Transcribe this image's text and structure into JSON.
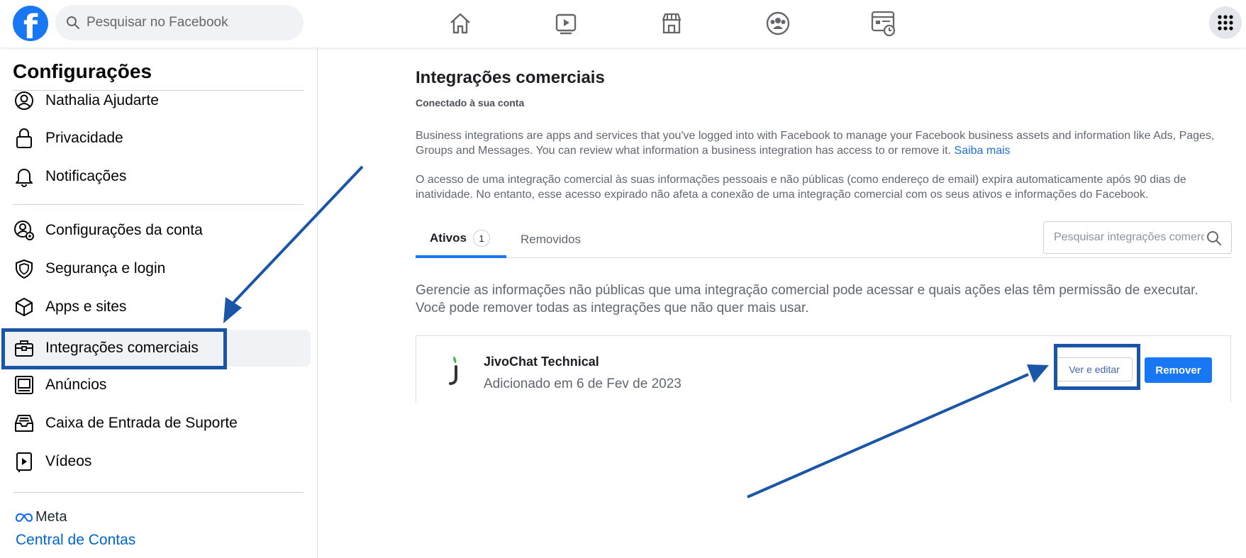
{
  "topbar": {
    "logo_glyph": "f",
    "search_placeholder": "Pesquisar no Facebook",
    "nav_icons": [
      "home-icon",
      "watch-icon",
      "marketplace-icon",
      "groups-icon",
      "gaming-icon"
    ],
    "menu_icon": "grid-menu-icon"
  },
  "sidebar": {
    "title": "Configurações",
    "items": [
      {
        "label": "Nathalia Ajudarte",
        "icon": "profile-icon"
      },
      {
        "label": "Privacidade",
        "icon": "lock-icon"
      },
      {
        "label": "Notificações",
        "icon": "bell-icon"
      },
      {
        "label": "Configurações da conta",
        "icon": "account-settings-icon"
      },
      {
        "label": "Segurança e login",
        "icon": "shield-icon"
      },
      {
        "label": "Apps e sites",
        "icon": "cube-icon"
      },
      {
        "label": "Integrações comerciais",
        "icon": "briefcase-icon",
        "active": true
      },
      {
        "label": "Anúncios",
        "icon": "ads-icon"
      },
      {
        "label": "Caixa de Entrada de Suporte",
        "icon": "inbox-icon"
      },
      {
        "label": "Vídeos",
        "icon": "video-icon"
      }
    ],
    "meta_label": "Meta",
    "central_link": "Central de Contas"
  },
  "main": {
    "title": "Integrações comerciais",
    "subtitle": "Conectado à sua conta",
    "desc1": "Business integrations are apps and services that you've logged into with Facebook to manage your Facebook business assets and information like Ads, Pages, Groups and Messages. You can review what information a business integration has access to or remove it.",
    "desc1_link": "Saiba mais",
    "desc2": "O acesso de uma integração comercial às suas informações pessoais e não públicas (como endereço de email) expira automaticamente após 90 dias de inatividade. No entanto, esse acesso expirado não afeta a conexão de uma integração comercial com os seus ativos e informações do Facebook.",
    "tabs": [
      {
        "label": "Ativos",
        "badge": "1",
        "active": true
      },
      {
        "label": "Removidos"
      }
    ],
    "search_placeholder": "Pesquisar integrações comerciais",
    "manage_text": "Gerencie as informações não públicas que uma integração comercial pode acessar e quais ações elas têm permissão de executar. Você pode remover todas as integrações que não quer mais usar.",
    "integration": {
      "name": "JivoChat Technical",
      "added": "Adicionado em 6 de Fev de 2023",
      "edit_label": "Ver e editar",
      "remove_label": "Remover"
    }
  },
  "colors": {
    "brand": "#1877f2",
    "annotation": "#1b55a8",
    "link": "#216fdb",
    "jivo_green": "#3fbf3f"
  }
}
